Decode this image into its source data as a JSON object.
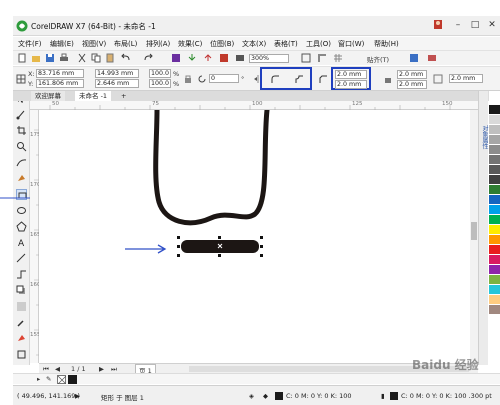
{
  "app": {
    "title": "CorelDRAW X7 (64-Bit) - 未命名 -1"
  },
  "menu": [
    "文件(F)",
    "编辑(E)",
    "视图(V)",
    "布局(L)",
    "排列(A)",
    "效果(C)",
    "位图(B)",
    "文本(X)",
    "表格(T)",
    "工具(O)",
    "窗口(W)",
    "帮助(H)"
  ],
  "toolbar": {
    "zoom": "300%",
    "snap_label": "贴齐(T)"
  },
  "props": {
    "x_label": "X:",
    "x": "83.716 mm",
    "y_label": "Y:",
    "y": "161.806 mm",
    "w": "14.993 mm",
    "h": "2.646 mm",
    "sx": "100.0",
    "sy": "100.0",
    "pct": "%",
    "rot": "0",
    "deg": "°",
    "corner_a": "2.0 mm",
    "corner_b": "2.0 mm",
    "corner_c": "2.0 mm",
    "corner_d": "2.0 mm",
    "outline": "2.0 mm"
  },
  "tabs": {
    "welcome": "欢迎屏幕",
    "doc": "未命名 -1",
    "add": "+"
  },
  "ruler": {
    "top_numbers": [
      "50",
      "75",
      "100",
      "125",
      "150"
    ],
    "left_numbers": [
      "175",
      "170",
      "165",
      "160",
      "155"
    ]
  },
  "pagenav": {
    "current": "1 / 1",
    "page_tab": "页 1"
  },
  "status": {
    "coords": "( 49.496, 141.169 )",
    "object": "矩形 于 图层 1",
    "fill": "C: 0 M: 0 Y: 0 K: 100",
    "outline": "C: 0 M: 0 Y: 0 K: 100  .300 pt"
  },
  "dock_label": "对象属性",
  "watermark": "Baidu 经验",
  "colors": {
    "accent_highlight": "#1f3fbf",
    "shape_fill": "#1c1614",
    "arrow": "#3050c8"
  },
  "palette": [
    "#1a1a1a",
    "#d9d9d9",
    "#bfbfbf",
    "#a6a6a6",
    "#8c8c8c",
    "#737373",
    "#595959",
    "#404040",
    "#2e7d32",
    "#1565c0",
    "#00a0e9",
    "#00b050",
    "#ffeb00",
    "#ff9800",
    "#e91e1e",
    "#d81b60",
    "#8e24aa",
    "#7cb342",
    "#26c6da",
    "#ffcc80",
    "#a1887f"
  ]
}
